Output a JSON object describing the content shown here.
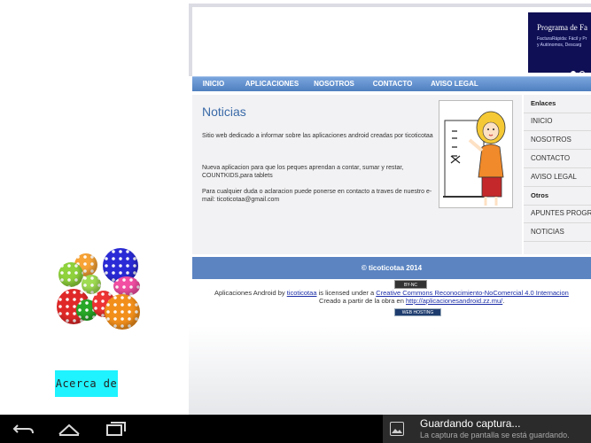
{
  "left_pane": {
    "about_button": "Acerca de"
  },
  "website": {
    "banner": {
      "title": "Programa de Fa",
      "subtitle_line1": "FacturaRápida: Fácil y Pr",
      "subtitle_line2": "y Autónomos, Descarg"
    },
    "nav": [
      "INICIO",
      "APLICACIONES",
      "NOSOTROS",
      "CONTACTO",
      "AVISO LEGAL"
    ],
    "main": {
      "title": "Noticias",
      "paragraph1": "Sitio web dedicado a informar sobre las aplicaciones android creadas por ticoticotaa",
      "paragraph2": "Nueva aplicacion para que los peques aprendan a contar, sumar y restar, COUNTKIDS,para tablets",
      "paragraph3": "Para cualquier duda o aclaracion puede ponerse en contacto a traves de nuestro e-mail: ticoticotaa@gmail.com"
    },
    "sidebar": {
      "links_heading": "Enlaces",
      "links": [
        "INICIO",
        "NOSOTROS",
        "CONTACTO",
        "AVISO LEGAL"
      ],
      "others_heading": "Otros",
      "others": [
        "APUNTES PROGR",
        "NOTICIAS"
      ]
    },
    "footer": {
      "copyright": "© ticoticotaa 2014",
      "cc_badge": "BY-NC",
      "license_prefix": "Aplicaciones Android by ",
      "author_link": "ticoticotaa",
      "license_mid": " is licensed under a ",
      "license_link": "Creative Commons Reconocimiento-NoComercial 4.0 Internacion",
      "based_prefix": "Creado a partir de la obra en ",
      "based_link": "http://aplicacionesandroid.zz.mu/",
      "based_suffix": ".",
      "host_badge": "WEB HOSTING"
    }
  },
  "notification": {
    "title": "Guardando captura...",
    "text": "La captura de pantalla se está guardando."
  },
  "colors": {
    "nav_blue": "#5b84c1",
    "title_blue": "#3a6aa8",
    "about_cyan": "#1ff3ff",
    "banner_navy": "#0f0f55"
  }
}
